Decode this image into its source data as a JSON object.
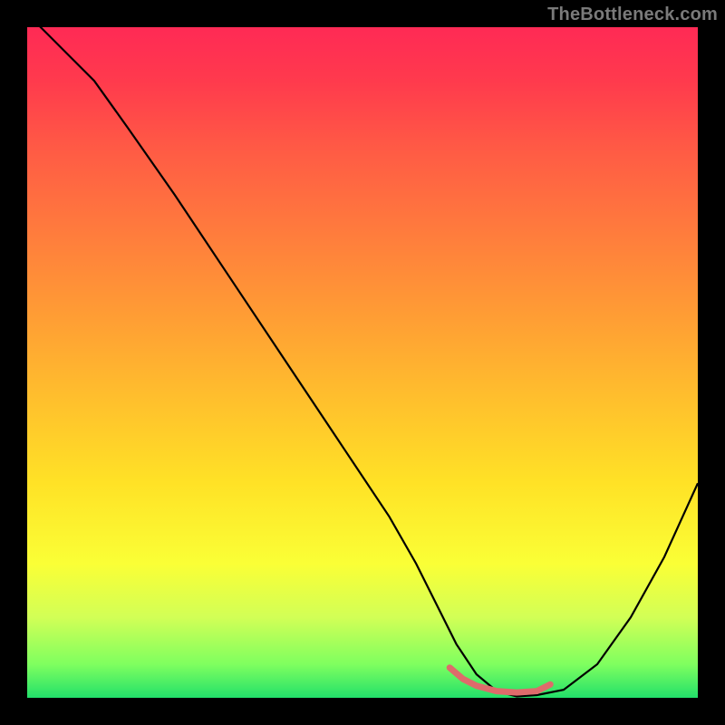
{
  "watermark": "TheBottleneck.com",
  "chart_data": {
    "type": "line",
    "title": "",
    "xlabel": "",
    "ylabel": "",
    "xlim": [
      0,
      100
    ],
    "ylim": [
      0,
      100
    ],
    "series": [
      {
        "name": "main-curve",
        "color": "#000000",
        "x": [
          0,
          3,
          6,
          10,
          15,
          22,
          30,
          38,
          46,
          54,
          58,
          61,
          64,
          67,
          70,
          73,
          76,
          80,
          85,
          90,
          95,
          100
        ],
        "y": [
          102,
          99,
          96,
          92,
          85,
          75,
          63,
          51,
          39,
          27,
          20,
          14,
          8,
          3.5,
          1,
          0.2,
          0.4,
          1.2,
          5,
          12,
          21,
          32
        ]
      },
      {
        "name": "min-region-highlight",
        "color": "#e06060",
        "x": [
          63,
          65,
          67,
          70,
          73,
          76,
          78
        ],
        "y": [
          4.5,
          2.8,
          1.8,
          1.0,
          0.8,
          1.0,
          2.0
        ]
      }
    ],
    "min_region": {
      "x_start": 63,
      "x_end": 78
    }
  }
}
